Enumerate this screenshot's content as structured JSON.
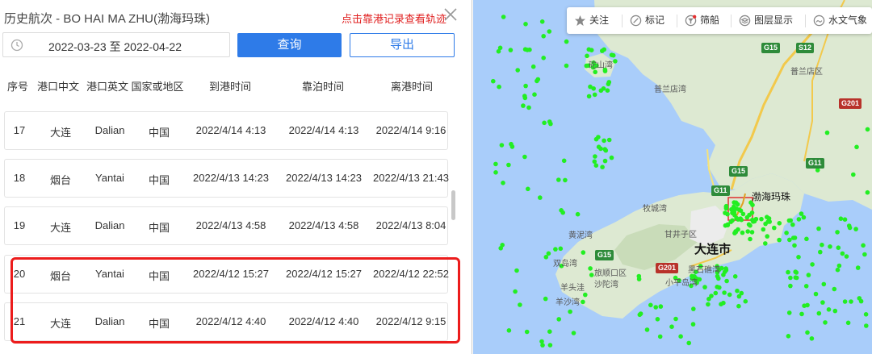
{
  "panel": {
    "title": "历史航次 - BO HAI MA ZHU(渤海玛珠)",
    "link": "点击靠港记录查看轨迹",
    "date_range": "2022-03-23 至 2022-04-22",
    "query_label": "查询",
    "export_label": "导出"
  },
  "columns": [
    "序号",
    "港口中文",
    "港口英文",
    "国家或地区",
    "到港时间",
    "靠泊时间",
    "离港时间"
  ],
  "rows": [
    {
      "no": "17",
      "cn": "大连",
      "en": "Dalian",
      "country": "中国",
      "arrive": "2022/4/14 4:13",
      "berth": "2022/4/14 4:13",
      "depart": "2022/4/14 9:16"
    },
    {
      "no": "18",
      "cn": "烟台",
      "en": "Yantai",
      "country": "中国",
      "arrive": "2022/4/13 14:23",
      "berth": "2022/4/13 14:23",
      "depart": "2022/4/13 21:43"
    },
    {
      "no": "19",
      "cn": "大连",
      "en": "Dalian",
      "country": "中国",
      "arrive": "2022/4/13 4:58",
      "berth": "2022/4/13 4:58",
      "depart": "2022/4/13 8:04"
    },
    {
      "no": "20",
      "cn": "烟台",
      "en": "Yantai",
      "country": "中国",
      "arrive": "2022/4/12 15:27",
      "berth": "2022/4/12 15:27",
      "depart": "2022/4/12 22:52"
    },
    {
      "no": "21",
      "cn": "大连",
      "en": "Dalian",
      "country": "中国",
      "arrive": "2022/4/12 4:40",
      "berth": "2022/4/12 4:40",
      "depart": "2022/4/12 9:15"
    }
  ],
  "toolbar": {
    "follow": "关注",
    "mark": "标记",
    "filter": "筛船",
    "layers": "图层显示",
    "weather": "水文气象"
  },
  "map": {
    "city": "大连市",
    "ship": "渤海玛珠",
    "labels": [
      "砣山湾",
      "普兰店湾",
      "普兰店区",
      "牧城湾",
      "黄泥湾",
      "双岛湾",
      "甘井子区",
      "旅顺口区",
      "羊头洼",
      "小平岛湾",
      "黑石礁湾",
      "沙陀湾",
      "羊沙湾"
    ],
    "roads": [
      "G15",
      "S12",
      "G201",
      "G11",
      "G15",
      "G11",
      "G15",
      "G201"
    ]
  },
  "colors": {
    "accent": "#2e7be8",
    "highlight": "#ec1c1c",
    "ships": "#22ee22",
    "sea": "#a9cdfa",
    "land": "#dde9d2"
  }
}
